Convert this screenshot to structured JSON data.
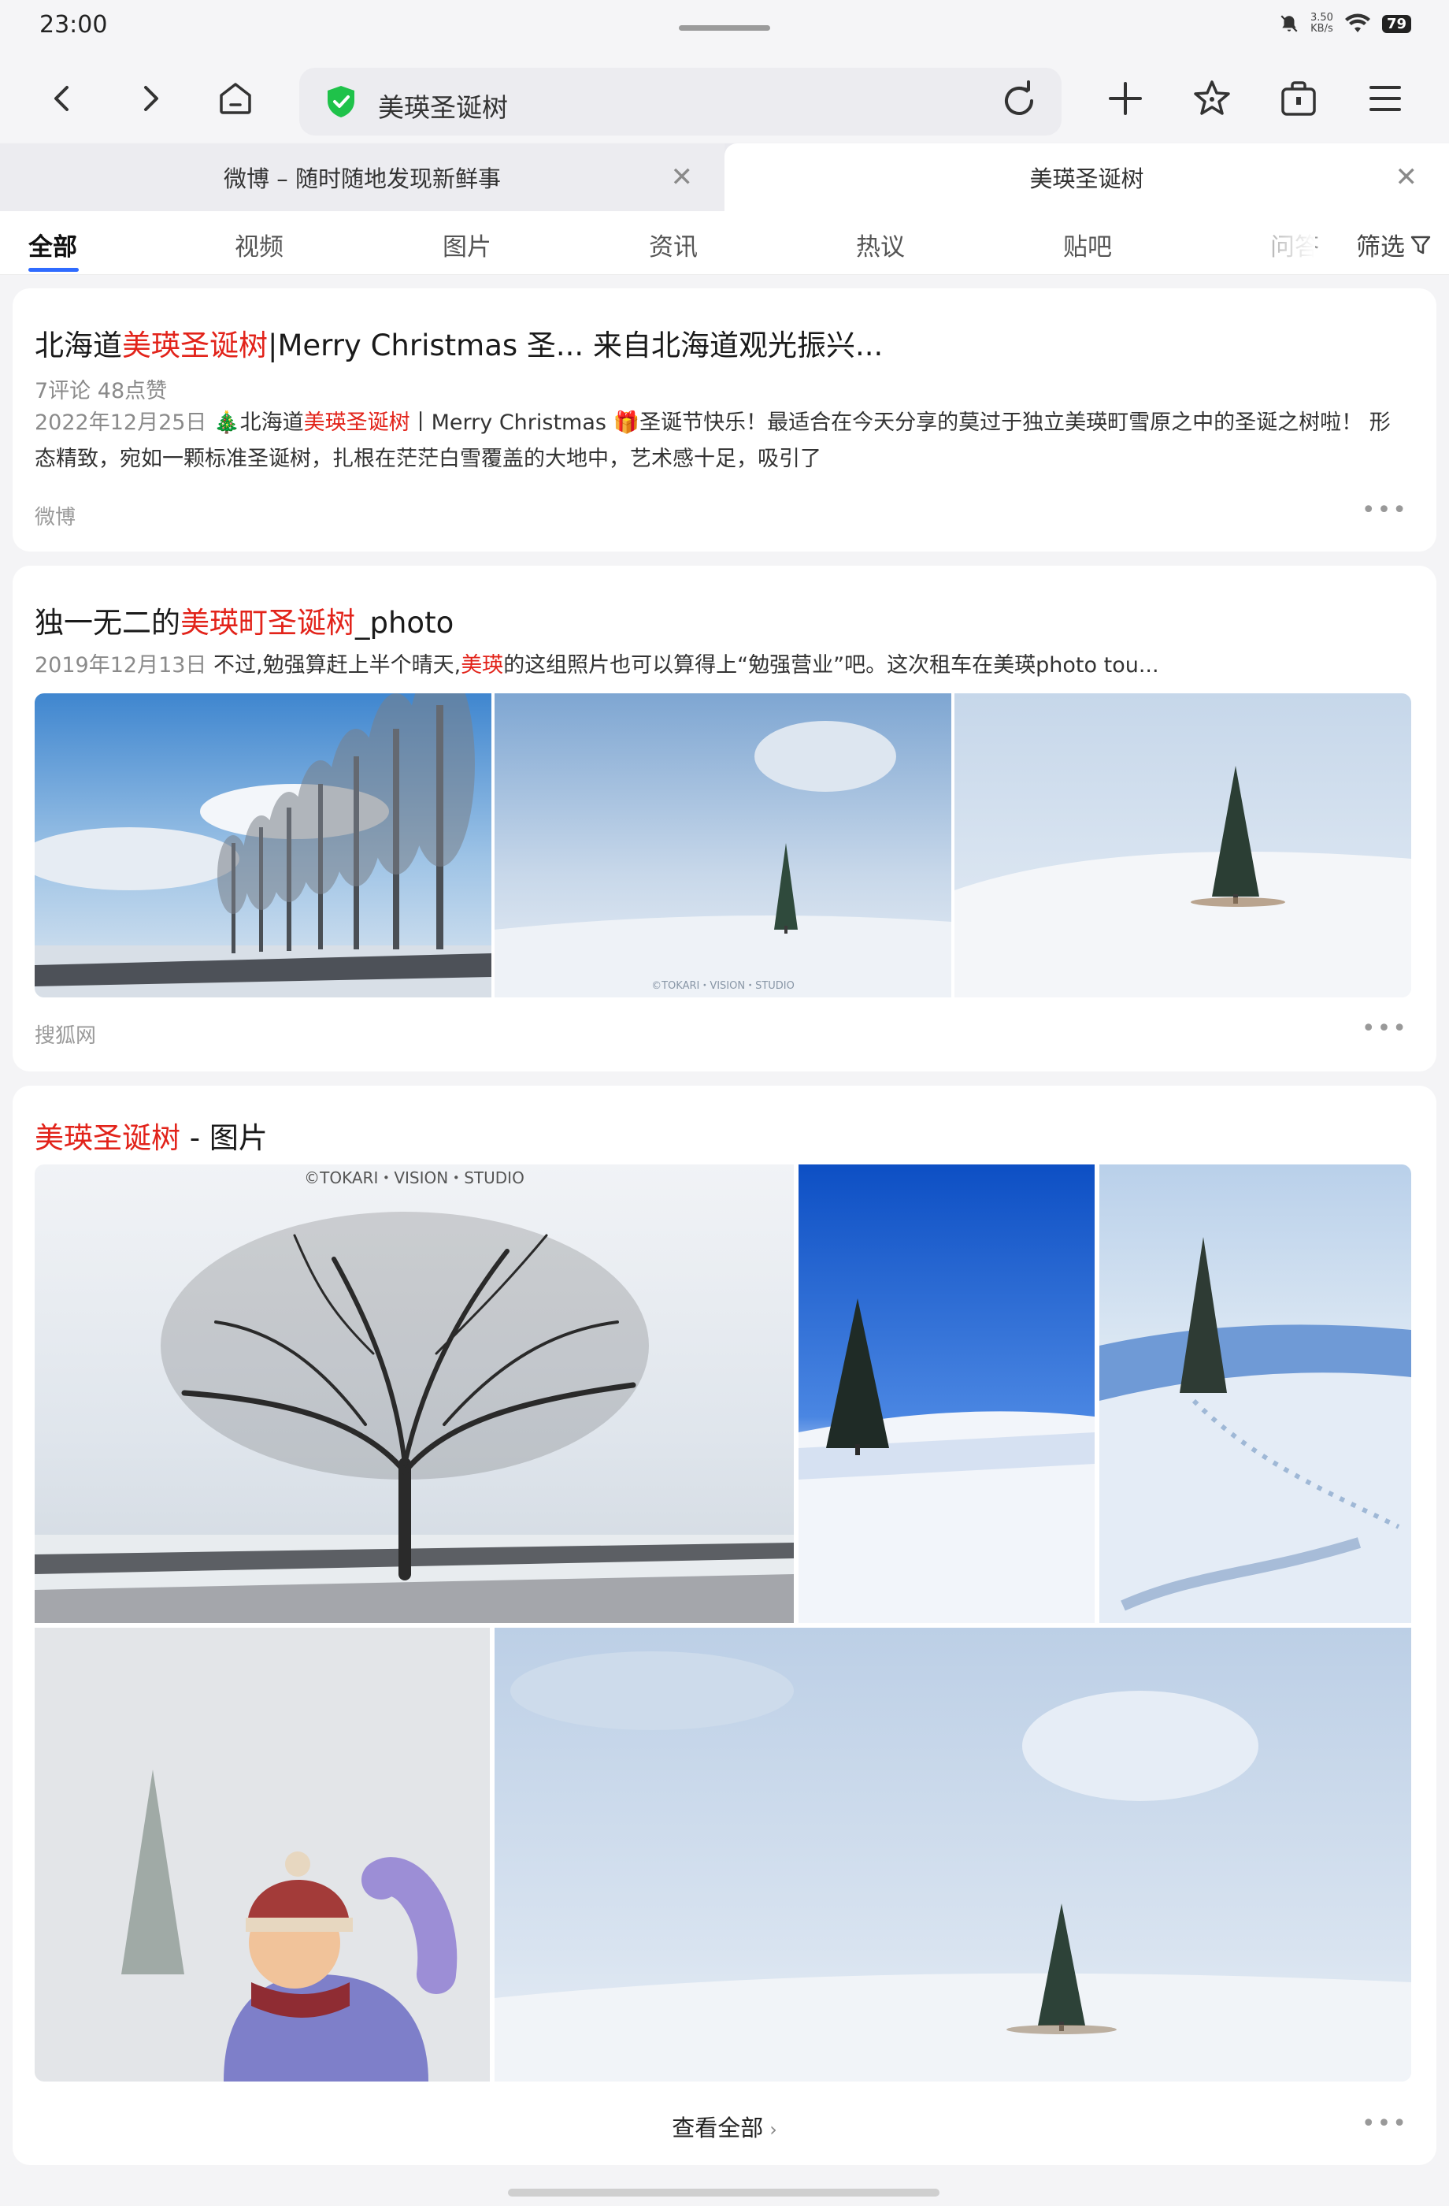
{
  "status": {
    "time": "23:00",
    "net_speed": "3.50",
    "net_unit": "KB/s",
    "battery": "79"
  },
  "toolbar": {
    "query": "美瑛圣诞树",
    "icons": [
      "back-icon",
      "forward-icon",
      "home-icon",
      "shield-icon",
      "reload-icon",
      "plus-icon",
      "star-icon",
      "bag-icon",
      "menu-icon"
    ]
  },
  "tabs": [
    {
      "label": "微博 – 随时随地发现新鲜事"
    },
    {
      "label": "美瑛圣诞树"
    }
  ],
  "categories": [
    "全部",
    "视频",
    "图片",
    "资讯",
    "热议",
    "贴吧",
    "问答"
  ],
  "filter_label": "筛选",
  "results": [
    {
      "title_pre": "北海道",
      "title_hl": "美瑛圣诞树",
      "title_post": "|Merry Christmas 圣... 来自北海道观光振兴...",
      "meta": "7评论  48点赞",
      "date": "2022年12月25日",
      "snip_a": " 🎄北海道",
      "snip_hl": "美瑛圣诞树",
      "snip_b": "丨Merry Christmas 🎁圣诞节快乐！最适合在今天分享的莫过于独立美瑛町雪原之中的圣诞之树啦！ 形态精致，宛如一颗标准圣诞树，扎根在茫茫白雪覆盖的大地中，艺术感十足，吸引了",
      "source": "微博"
    },
    {
      "title_pre": "独一无二的",
      "title_hl": "美瑛町圣诞树",
      "title_post": "_photo",
      "date": "2019年12月13日",
      "snip_a": "  不过,勉强算赶上半个晴天,",
      "snip_hl": "美瑛",
      "snip_b": "的这组照片也可以算得上“勉强营业”吧。这次租车在美瑛photo tou...",
      "source": "搜狐网"
    },
    {
      "title_hl": "美瑛圣诞树",
      "title_post": " - 图片",
      "watermark": "©TOKARI・VISION・STUDIO",
      "watermark_small": "©TOKARI・VISION・STUDIO",
      "view_all": "查看全部"
    }
  ],
  "colors": {
    "highlight": "#e2231a",
    "accent": "#2f6bff",
    "shield": "#1fc24a"
  }
}
